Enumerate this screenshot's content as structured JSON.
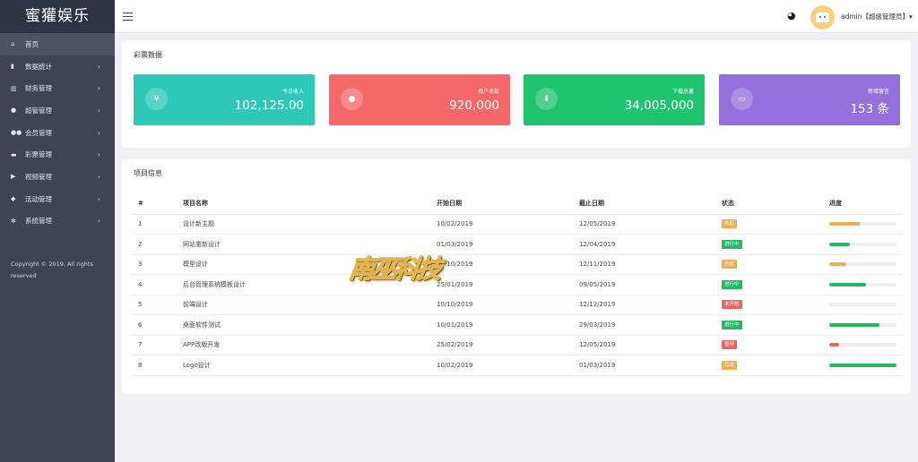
{
  "brand": {
    "title": "蜜獾娱乐"
  },
  "sidebar": {
    "items": [
      {
        "label": "首页",
        "icon": "home-icon",
        "glyph": "⌂",
        "has_arrow": false,
        "active": true
      },
      {
        "label": "数据统计",
        "icon": "bar-chart-icon",
        "glyph": "▮",
        "has_arrow": true
      },
      {
        "label": "财务管理",
        "icon": "bank-icon",
        "glyph": "▥",
        "has_arrow": true
      },
      {
        "label": "超管管理",
        "icon": "user-icon",
        "glyph": "●",
        "has_arrow": true
      },
      {
        "label": "会员管理",
        "icon": "users-icon",
        "glyph": "●●",
        "has_arrow": true
      },
      {
        "label": "彩票管理",
        "icon": "gamepad-icon",
        "glyph": "▬",
        "has_arrow": true
      },
      {
        "label": "视频管理",
        "icon": "video-icon",
        "glyph": "▶",
        "has_arrow": true
      },
      {
        "label": "活动管理",
        "icon": "tag-icon",
        "glyph": "◆",
        "has_arrow": true
      },
      {
        "label": "系统管理",
        "icon": "gear-icon",
        "glyph": "✻",
        "has_arrow": true
      }
    ],
    "arrow": "›",
    "copyright_line1": "Copyright © 2019. All rights",
    "copyright_line2": "reserved"
  },
  "topbar": {
    "menu_icon": "hamburger-icon",
    "theme_icon": "palette-icon",
    "theme_glyph": "◕",
    "user_label": "admin【超级管理员】▾"
  },
  "lottery_panel": {
    "title": "彩票数据",
    "cards": [
      {
        "label": "今日收入",
        "value": "102,125.00",
        "icon": "yen-icon",
        "glyph": "¥",
        "color": "#2ec8b8"
      },
      {
        "label": "用户总数",
        "value": "920,000",
        "icon": "user-icon",
        "glyph": "●",
        "color": "#f5686a"
      },
      {
        "label": "下载总量",
        "value": "34,005,000",
        "icon": "download-icon",
        "glyph": "⬇",
        "color": "#1fc46e"
      },
      {
        "label": "新增留言",
        "value": "153 条",
        "icon": "monitor-icon",
        "glyph": "▭",
        "color": "#9370dc"
      }
    ]
  },
  "project_panel": {
    "title": "项目信息",
    "columns": [
      "#",
      "项目名称",
      "开始日期",
      "截止日期",
      "状态",
      "进度"
    ],
    "rows": [
      {
        "no": "1",
        "name": "设计新主题",
        "start": "10/02/2019",
        "end": "12/05/2019",
        "status": "挂起",
        "status_color": "#f0ad4e",
        "progress": 0.45,
        "progress_color": "#f0ad4e"
      },
      {
        "no": "2",
        "name": "网站重新设计",
        "start": "01/03/2019",
        "end": "12/04/2019",
        "status": "进行中",
        "status_color": "#22b864",
        "progress": 0.3,
        "progress_color": "#22b864"
      },
      {
        "no": "3",
        "name": "模型设计",
        "start": "10/10/2019",
        "end": "12/11/2019",
        "status": "挂起",
        "status_color": "#f0ad4e",
        "progress": 0.25,
        "progress_color": "#f0ad4e"
      },
      {
        "no": "4",
        "name": "后台管理系统模板设计",
        "start": "25/01/2019",
        "end": "09/05/2019",
        "status": "进行中",
        "status_color": "#22b864",
        "progress": 0.55,
        "progress_color": "#22b864"
      },
      {
        "no": "5",
        "name": "前端设计",
        "start": "10/10/2019",
        "end": "12/12/2019",
        "status": "未开始",
        "status_color": "#f06363",
        "progress": 0,
        "progress_color": "#f06363"
      },
      {
        "no": "6",
        "name": "桌面软件测试",
        "start": "10/01/2019",
        "end": "29/03/2019",
        "status": "进行中",
        "status_color": "#22b864",
        "progress": 0.75,
        "progress_color": "#22b864"
      },
      {
        "no": "7",
        "name": "APP改版开发",
        "start": "25/02/2019",
        "end": "12/05/2019",
        "status": "暂停",
        "status_color": "#f06363",
        "progress": 0.15,
        "progress_color": "#f06363"
      },
      {
        "no": "8",
        "name": "Logo设计",
        "start": "10/02/2019",
        "end": "01/03/2019",
        "status": "完成",
        "status_color": "#f0ad4e",
        "progress": 1,
        "progress_color": "#22b864"
      }
    ]
  },
  "watermark": {
    "text": "南巫科技"
  }
}
